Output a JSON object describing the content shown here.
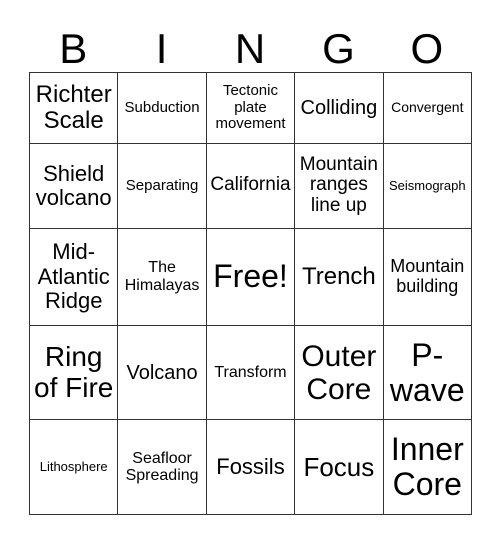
{
  "header": [
    "B",
    "I",
    "N",
    "G",
    "O"
  ],
  "cells": [
    [
      "Richter Scale",
      "Subduction",
      "Tectonic plate movement",
      "Colliding",
      "Convergent"
    ],
    [
      "Shield volcano",
      "Separating",
      "California",
      "Mountain ranges line up",
      "Seismograph"
    ],
    [
      "Mid-Atlantic Ridge",
      "The Himalayas",
      "Free!",
      "Trench",
      "Mountain building"
    ],
    [
      "Ring of Fire",
      "Volcano",
      "Transform",
      "Outer Core",
      "P-wave"
    ],
    [
      "Lithosphere",
      "Seafloor Spreading",
      "Fossils",
      "Focus",
      "Inner Core"
    ]
  ]
}
